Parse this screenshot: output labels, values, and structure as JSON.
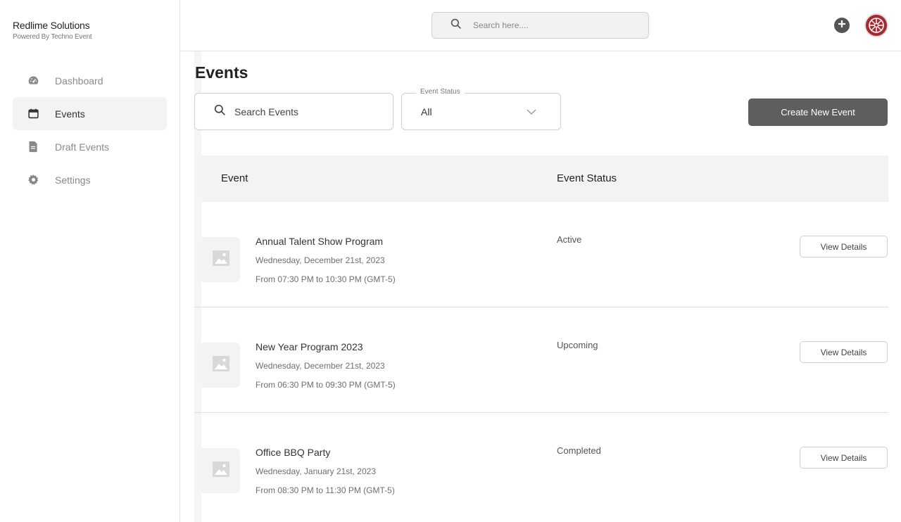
{
  "brand": {
    "name": "Redlime Solutions",
    "subtitle": "Powered By Techno Event"
  },
  "sidebar": {
    "items": [
      {
        "label": "Dashboard",
        "icon": "dashboard-gauge-icon",
        "active": false
      },
      {
        "label": "Events",
        "icon": "calendar-icon",
        "active": true
      },
      {
        "label": "Draft Events",
        "icon": "document-icon",
        "active": false
      },
      {
        "label": "Settings",
        "icon": "gear-icon",
        "active": false
      }
    ]
  },
  "topbar": {
    "search_placeholder": "Search here....",
    "avatar_color": "#a82731"
  },
  "page": {
    "title": "Events",
    "search_placeholder": "Search Events",
    "status_filter": {
      "legend": "Event Status",
      "selected": "All"
    },
    "create_button": "Create New Event"
  },
  "table": {
    "columns": [
      "Event",
      "Event Status"
    ],
    "rows": [
      {
        "name": "Annual Talent Show Program",
        "date": "Wednesday, December 21st, 2023",
        "time": "From 07:30 PM to 10:30 PM (GMT-5)",
        "status": "Active",
        "action": "View Details"
      },
      {
        "name": "New Year Program 2023",
        "date": "Wednesday, December 21st, 2023",
        "time": "From 06:30 PM to 09:30 PM (GMT-5)",
        "status": "Upcoming",
        "action": "View Details"
      },
      {
        "name": "Office BBQ Party",
        "date": "Wednesday, January 21st, 2023",
        "time": "From 08:30 PM to 11:30 PM (GMT-5)",
        "status": "Completed",
        "action": "View Details"
      }
    ]
  }
}
